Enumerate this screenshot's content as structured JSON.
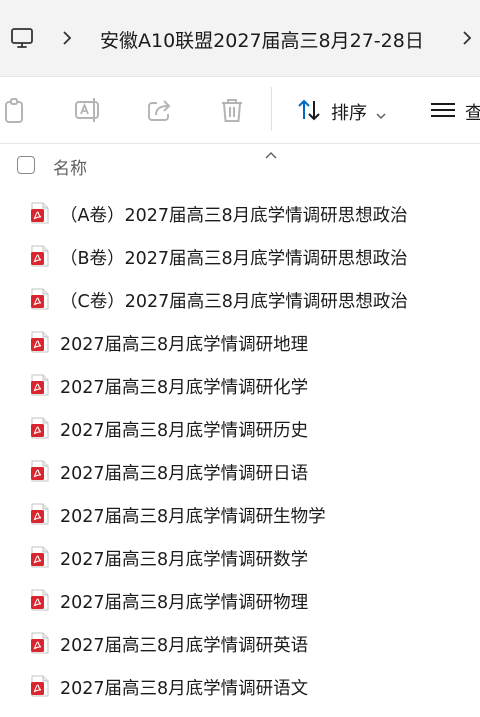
{
  "address_bar": {
    "computer_icon": "computer-icon",
    "breadcrumb": "安徽A10联盟2027届高三8月27-28日"
  },
  "toolbar": {
    "copy_icon": "copy-icon",
    "rename_icon": "rename-icon",
    "share_icon": "share-icon",
    "delete_icon": "delete-icon",
    "sort_label": "排序",
    "view_label": "查"
  },
  "list_header": {
    "name_label": "名称"
  },
  "files": [
    {
      "name": "（A卷）2027届高三8月底学情调研思想政治",
      "icon": "pdf-icon"
    },
    {
      "name": "（B卷）2027届高三8月底学情调研思想政治",
      "icon": "pdf-icon"
    },
    {
      "name": "（C卷）2027届高三8月底学情调研思想政治",
      "icon": "pdf-icon"
    },
    {
      "name": "2027届高三8月底学情调研地理",
      "icon": "pdf-icon"
    },
    {
      "name": "2027届高三8月底学情调研化学",
      "icon": "pdf-icon"
    },
    {
      "name": "2027届高三8月底学情调研历史",
      "icon": "pdf-icon"
    },
    {
      "name": "2027届高三8月底学情调研日语",
      "icon": "pdf-icon"
    },
    {
      "name": "2027届高三8月底学情调研生物学",
      "icon": "pdf-icon"
    },
    {
      "name": "2027届高三8月底学情调研数学",
      "icon": "pdf-icon"
    },
    {
      "name": "2027届高三8月底学情调研物理",
      "icon": "pdf-icon"
    },
    {
      "name": "2027届高三8月底学情调研英语",
      "icon": "pdf-icon"
    },
    {
      "name": "2027届高三8月底学情调研语文",
      "icon": "pdf-icon"
    }
  ],
  "colors": {
    "pdf_red": "#d9262e",
    "disabled_icon": "#b5b5b5",
    "accent_blue": "#0067c0"
  }
}
